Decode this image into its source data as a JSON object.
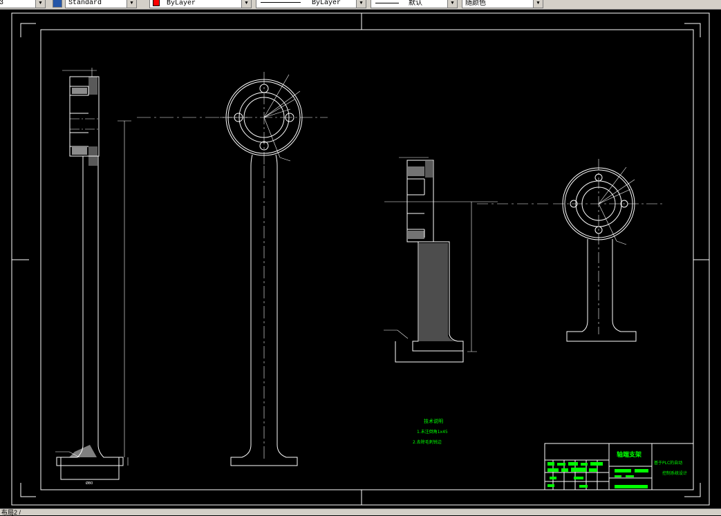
{
  "toolbar": {
    "left_value": "3",
    "text_style": "Standard",
    "color": "ByLayer",
    "color_swatch": "#ff0000",
    "linetype": "ByLayer",
    "lineweight": "默认",
    "plot_style": "随颜色"
  },
  "drawing": {
    "dim_label": "Ø80",
    "tech_title": "技术说明",
    "tech_line1": "1.未注倒角1x45",
    "tech_line2": "2.去除毛刺锐边",
    "part_name": "轴端支架",
    "design_title_1": "基于PLC的自动",
    "design_title_2": "控制系统设计"
  },
  "colors": {
    "line": "#ffffff",
    "annotation": "#00ff00",
    "title_block_fill": "#00ff00"
  },
  "status": {
    "layout_tab": "布局2 /"
  }
}
